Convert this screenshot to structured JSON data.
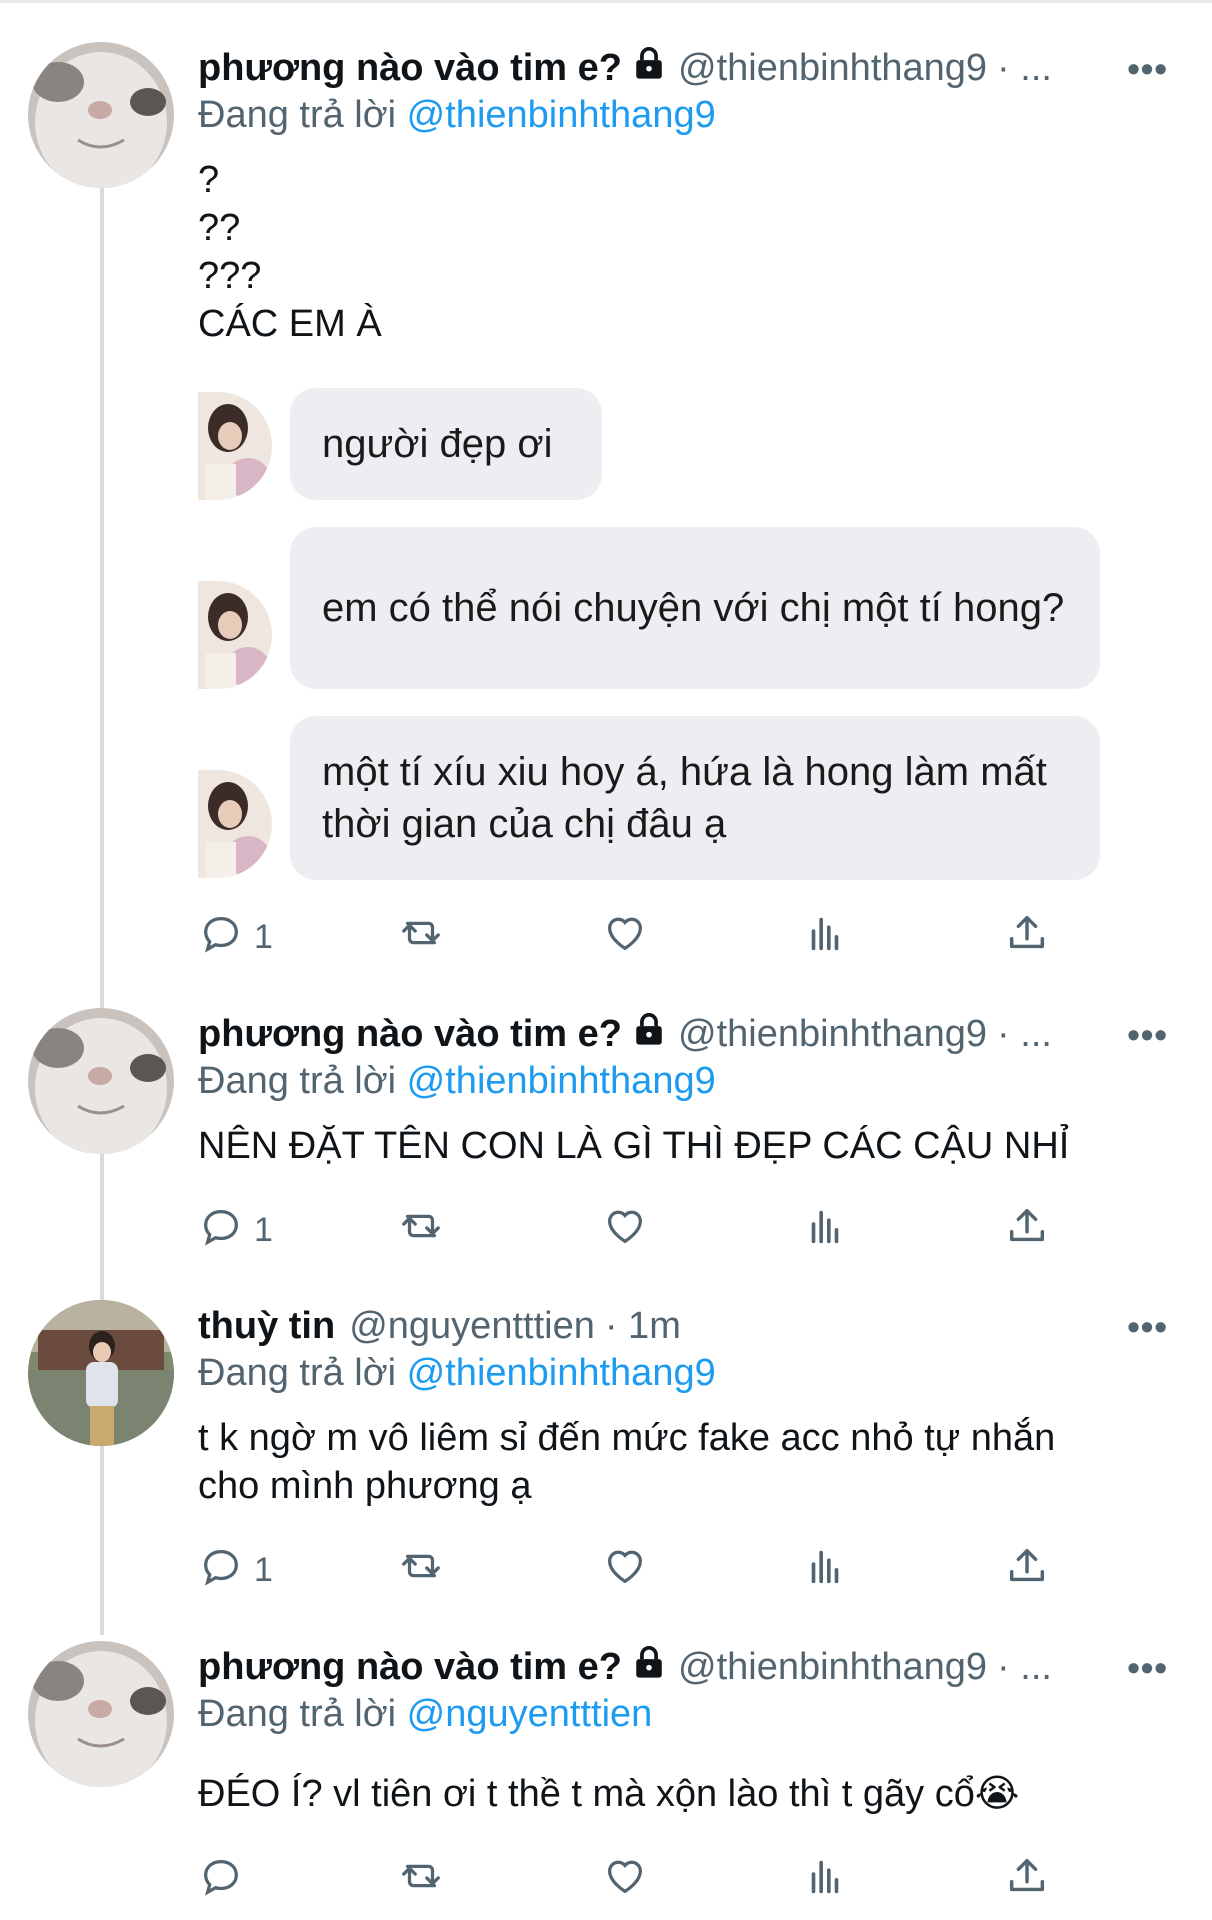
{
  "tweets": [
    {
      "name": "phương nào vào tim e?",
      "handle": "@thienbinhthang9",
      "meta": "· ...",
      "more": "•••",
      "reply_prefix": "Đang trả lời",
      "reply_to": "@thienbinhthang9",
      "lines": [
        "?",
        "??",
        "???",
        "CÁC EM À"
      ],
      "dm_messages": [
        "người đẹp ơi",
        "em có thể nói chuyện với chị một tí hong?",
        "một tí xíu xiu hoy á, hứa là hong làm mất thời gian của chị đâu ạ"
      ],
      "actions": {
        "reply_count": "1"
      }
    },
    {
      "name": "phương nào vào tim e?",
      "handle": "@thienbinhthang9",
      "meta": "· ...",
      "more": "•••",
      "reply_prefix": "Đang trả lời",
      "reply_to": "@thienbinhthang9",
      "lines": [
        "NÊN ĐẶT TÊN CON LÀ GÌ THÌ ĐẸP CÁC CẬU NHỈ"
      ],
      "actions": {
        "reply_count": "1"
      }
    },
    {
      "name": "thuỳ tin",
      "handle": "@nguyentttien",
      "meta": "· 1m",
      "more": "•••",
      "reply_prefix": "Đang trả lời",
      "reply_to": "@thienbinhthang9",
      "lines": [
        "t k ngờ m vô liêm sỉ đến mức fake acc nhỏ tự nhắn",
        "cho mình phương ạ"
      ],
      "actions": {
        "reply_count": "1"
      }
    },
    {
      "name": "phương nào vào tim e?",
      "handle": "@thienbinhthang9",
      "meta": "· ...",
      "more": "•••",
      "reply_prefix": "Đang trả lời",
      "reply_to": "@nguyentttien",
      "lines": [
        "ĐÉO Í? vl tiên ơi t thề t mà xộn lào thì t gãy cổ😭"
      ],
      "actions": {
        "reply_count": ""
      }
    }
  ],
  "colors": {
    "link": "#1d9bf0",
    "secondary": "#536471",
    "bubble": "#eceef2"
  },
  "icons": [
    "lock-icon",
    "more-icon",
    "reply-icon",
    "retweet-icon",
    "like-icon",
    "views-icon",
    "share-icon"
  ]
}
